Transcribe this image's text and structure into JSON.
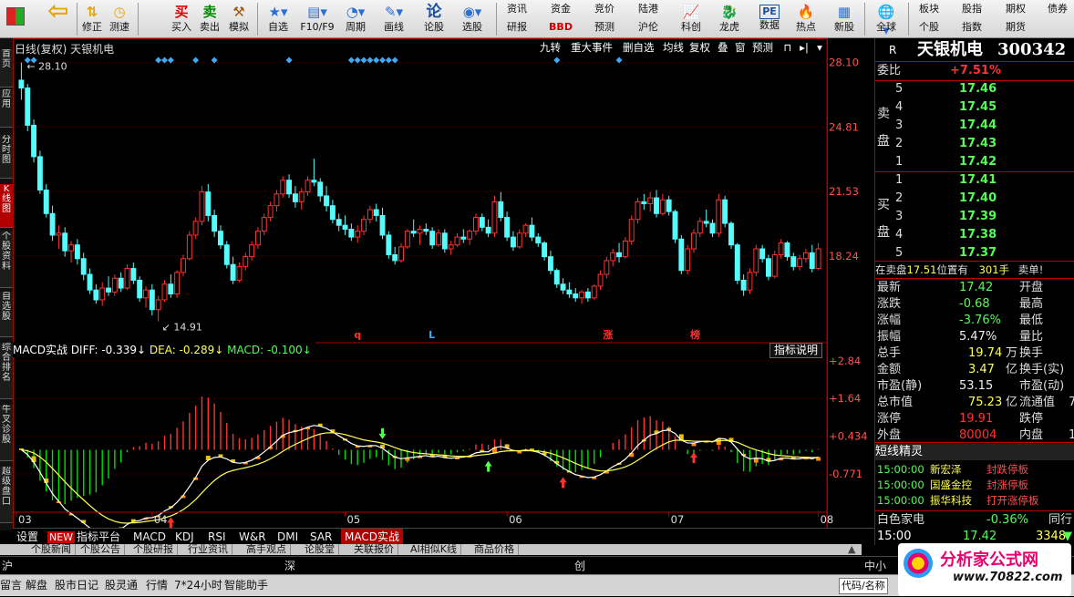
{
  "toolbar": {
    "buttons": [
      {
        "label": "",
        "icon": "grid-icon"
      },
      {
        "label": "",
        "icon": "back-arrow-icon"
      },
      {
        "label": "修正",
        "icon": "up-down-arrows-icon"
      },
      {
        "label": "测速",
        "icon": "clock-icon"
      },
      {
        "label": "买入",
        "icon": "buy-icon",
        "glyph": "买"
      },
      {
        "label": "卖出",
        "icon": "sell-icon",
        "glyph": "卖"
      },
      {
        "label": "模拟",
        "icon": "hammer-icon"
      },
      {
        "label": "自选",
        "icon": "star-icon"
      },
      {
        "label": "F10/F9",
        "icon": "document-icon"
      },
      {
        "label": "周期",
        "icon": "cycle-icon"
      },
      {
        "label": "画线",
        "icon": "pencil-icon"
      },
      {
        "label": "论股",
        "icon": "talk-icon",
        "glyph": "论"
      },
      {
        "label": "选股",
        "icon": "select-icon"
      },
      {
        "label": "科创",
        "icon": "chart-icon"
      },
      {
        "label": "龙虎",
        "icon": "dragon-icon"
      },
      {
        "label": "数据",
        "icon": "pe-icon",
        "glyph": "PE"
      },
      {
        "label": "热点",
        "icon": "hot-icon"
      },
      {
        "label": "新股",
        "icon": "new-stock-icon"
      },
      {
        "label": "全球",
        "icon": "globe-icon"
      }
    ],
    "grid_top": [
      "资讯",
      "资金",
      "竞价",
      "陆港",
      "板块",
      "股指",
      "期权",
      "债券"
    ],
    "grid_bottom": [
      "研报",
      "BBD",
      "预测",
      "沪伦",
      "个股",
      "指数",
      "期货"
    ]
  },
  "left_tabs": [
    "首页",
    "应用",
    "分时图",
    "K线图",
    "个股资料",
    "自选股",
    "综合排名",
    "牛叉诊股",
    "超级盘口"
  ],
  "chart": {
    "title": "日线(复权)  天银机电",
    "menu": [
      "九转",
      "重大事件",
      "删自选",
      "均线",
      "复权",
      "叠",
      "窗",
      "预测"
    ],
    "high_label": "28.10",
    "low_label": "14.91",
    "price_ticks": [
      "28.10",
      "24.81",
      "21.53",
      "18.24"
    ],
    "macd_ticks": [
      "+2.84",
      "+1.64",
      "+0.434",
      "-0.771"
    ],
    "date_labels": [
      "03",
      "04",
      "05",
      "06",
      "07",
      "08"
    ],
    "markers": [
      "q",
      "L",
      "涨",
      "榜"
    ],
    "macd_header": {
      "name": "MACD实战",
      "diff": "DIFF: -0.339↓",
      "dea": "DEA: -0.289↓",
      "macd": "MACD: -0.100↓"
    },
    "indicator_button": "指标说明",
    "colors": {
      "up": "#ff3232",
      "down": "#54fcfc",
      "diff": "#ffffff",
      "dea": "#ffff54",
      "macd": "#00e000",
      "signal": "#3fa9f5"
    }
  },
  "chart_data": {
    "type": "candlestick",
    "ylim": [
      14.0,
      28.5
    ],
    "note": "",
    "ohlc": [
      [
        27.2,
        28.1,
        26.2,
        26.8
      ],
      [
        26.8,
        27.0,
        24.6,
        24.9
      ],
      [
        24.9,
        25.2,
        23.0,
        23.3
      ],
      [
        23.3,
        23.6,
        21.4,
        21.6
      ],
      [
        21.6,
        21.9,
        20.2,
        20.4
      ],
      [
        20.4,
        20.8,
        19.0,
        19.3
      ],
      [
        19.3,
        19.8,
        18.6,
        19.4
      ],
      [
        19.4,
        19.7,
        18.2,
        18.5
      ],
      [
        18.5,
        19.0,
        17.9,
        18.8
      ],
      [
        18.8,
        19.1,
        17.8,
        18.1
      ],
      [
        18.1,
        18.4,
        17.0,
        17.3
      ],
      [
        17.3,
        17.6,
        16.3,
        16.5
      ],
      [
        16.5,
        16.8,
        15.8,
        16.0
      ],
      [
        16.0,
        16.9,
        15.7,
        16.6
      ],
      [
        16.6,
        17.2,
        16.2,
        16.4
      ],
      [
        16.4,
        17.3,
        16.2,
        17.1
      ],
      [
        17.1,
        17.4,
        16.4,
        16.6
      ],
      [
        16.6,
        17.8,
        16.5,
        17.6
      ],
      [
        17.6,
        17.9,
        16.8,
        17.0
      ],
      [
        17.0,
        17.2,
        15.9,
        16.1
      ],
      [
        16.1,
        16.7,
        15.6,
        16.5
      ],
      [
        16.5,
        16.8,
        15.2,
        15.5
      ],
      [
        15.5,
        16.2,
        14.9,
        16.0
      ],
      [
        16.0,
        17.0,
        15.9,
        16.8
      ],
      [
        16.8,
        17.3,
        16.1,
        16.3
      ],
      [
        16.3,
        17.5,
        16.1,
        17.4
      ],
      [
        17.4,
        18.3,
        17.2,
        18.1
      ],
      [
        18.1,
        19.5,
        18.0,
        19.3
      ],
      [
        19.3,
        20.2,
        19.1,
        20.0
      ],
      [
        20.0,
        21.8,
        19.8,
        21.5
      ],
      [
        21.5,
        21.9,
        20.0,
        20.3
      ],
      [
        20.3,
        20.6,
        19.2,
        19.5
      ],
      [
        19.5,
        19.8,
        18.6,
        18.8
      ],
      [
        18.8,
        19.0,
        17.6,
        17.8
      ],
      [
        17.8,
        18.2,
        16.8,
        17.0
      ],
      [
        17.0,
        17.9,
        16.9,
        17.7
      ],
      [
        17.7,
        18.4,
        17.5,
        18.2
      ],
      [
        18.2,
        19.0,
        18.0,
        18.8
      ],
      [
        18.8,
        19.7,
        18.6,
        19.5
      ],
      [
        19.5,
        20.4,
        19.3,
        20.2
      ],
      [
        20.2,
        21.0,
        20.0,
        20.8
      ],
      [
        20.8,
        21.6,
        20.5,
        21.4
      ],
      [
        21.4,
        22.3,
        21.2,
        22.1
      ],
      [
        22.1,
        22.4,
        21.2,
        21.4
      ],
      [
        21.4,
        21.8,
        20.7,
        21.0
      ],
      [
        21.0,
        21.7,
        20.6,
        21.5
      ],
      [
        21.5,
        22.3,
        21.3,
        22.1
      ],
      [
        22.1,
        23.2,
        21.8,
        22.0
      ],
      [
        22.0,
        22.2,
        21.0,
        21.3
      ],
      [
        21.3,
        21.8,
        20.5,
        20.8
      ],
      [
        20.8,
        21.1,
        19.9,
        20.1
      ],
      [
        20.1,
        20.4,
        19.5,
        19.8
      ],
      [
        19.8,
        20.3,
        19.3,
        19.6
      ],
      [
        19.6,
        19.9,
        19.0,
        19.2
      ],
      [
        19.2,
        19.8,
        18.9,
        19.5
      ],
      [
        19.5,
        20.3,
        19.3,
        20.1
      ],
      [
        20.1,
        20.8,
        19.9,
        20.6
      ],
      [
        20.6,
        20.9,
        20.0,
        20.3
      ],
      [
        20.3,
        20.7,
        19.1,
        19.3
      ],
      [
        19.3,
        19.5,
        18.1,
        18.3
      ],
      [
        18.3,
        18.7,
        17.8,
        18.0
      ],
      [
        18.0,
        18.9,
        17.9,
        18.7
      ],
      [
        18.7,
        19.6,
        18.6,
        19.5
      ],
      [
        19.5,
        20.1,
        19.2,
        19.4
      ],
      [
        19.4,
        19.8,
        18.8,
        19.6
      ],
      [
        19.6,
        19.9,
        19.3,
        19.5
      ],
      [
        19.5,
        19.7,
        18.6,
        18.8
      ],
      [
        18.8,
        19.6,
        18.7,
        19.4
      ],
      [
        19.4,
        19.6,
        18.4,
        18.6
      ],
      [
        18.6,
        19.0,
        18.3,
        18.8
      ],
      [
        18.8,
        19.4,
        18.7,
        19.2
      ],
      [
        19.2,
        19.6,
        18.9,
        19.1
      ],
      [
        19.1,
        19.6,
        18.8,
        19.5
      ],
      [
        19.5,
        20.4,
        19.3,
        20.2
      ],
      [
        20.2,
        20.4,
        19.5,
        19.7
      ],
      [
        19.7,
        20.1,
        19.2,
        19.4
      ],
      [
        19.4,
        21.3,
        19.2,
        21.0
      ],
      [
        21.0,
        21.5,
        20.0,
        20.2
      ],
      [
        20.2,
        20.5,
        19.0,
        19.2
      ],
      [
        19.2,
        19.5,
        18.5,
        18.7
      ],
      [
        18.7,
        19.6,
        18.6,
        19.4
      ],
      [
        19.4,
        19.9,
        19.2,
        19.8
      ],
      [
        19.8,
        20.2,
        19.0,
        19.2
      ],
      [
        19.2,
        19.4,
        18.7,
        18.9
      ],
      [
        18.9,
        19.0,
        18.0,
        18.2
      ],
      [
        18.2,
        18.5,
        17.3,
        17.5
      ],
      [
        17.5,
        17.6,
        16.6,
        16.8
      ],
      [
        16.8,
        17.1,
        16.3,
        16.5
      ],
      [
        16.5,
        16.9,
        16.1,
        16.3
      ],
      [
        16.3,
        16.6,
        15.9,
        16.1
      ],
      [
        16.1,
        16.5,
        15.8,
        16.4
      ],
      [
        16.4,
        16.6,
        15.9,
        16.1
      ],
      [
        16.1,
        16.8,
        16.0,
        16.7
      ],
      [
        16.7,
        17.5,
        16.5,
        17.3
      ],
      [
        17.3,
        18.2,
        17.1,
        18.0
      ],
      [
        18.0,
        18.6,
        17.7,
        18.4
      ],
      [
        18.4,
        18.9,
        17.9,
        18.2
      ],
      [
        18.2,
        19.2,
        18.1,
        19.0
      ],
      [
        19.0,
        20.3,
        18.8,
        20.1
      ],
      [
        20.1,
        21.2,
        19.9,
        21.0
      ],
      [
        21.0,
        21.4,
        20.6,
        20.9
      ],
      [
        20.9,
        21.5,
        20.5,
        21.2
      ],
      [
        21.2,
        21.6,
        20.2,
        20.4
      ],
      [
        20.4,
        21.4,
        20.3,
        21.1
      ],
      [
        21.1,
        21.3,
        20.3,
        20.5
      ],
      [
        20.5,
        20.6,
        18.9,
        19.1
      ],
      [
        19.1,
        19.3,
        17.3,
        17.5
      ],
      [
        17.5,
        18.8,
        17.3,
        18.6
      ],
      [
        18.6,
        19.6,
        18.4,
        19.4
      ],
      [
        19.4,
        20.2,
        19.2,
        20.0
      ],
      [
        20.0,
        20.6,
        19.7,
        19.9
      ],
      [
        19.9,
        20.1,
        19.2,
        19.4
      ],
      [
        19.4,
        21.4,
        19.2,
        21.1
      ],
      [
        21.1,
        21.3,
        19.7,
        19.9
      ],
      [
        19.9,
        20.0,
        18.6,
        18.8
      ],
      [
        18.8,
        18.9,
        16.8,
        17.0
      ],
      [
        17.0,
        17.3,
        16.2,
        16.5
      ],
      [
        16.5,
        17.6,
        16.3,
        17.4
      ],
      [
        17.4,
        18.8,
        17.2,
        18.6
      ],
      [
        18.6,
        18.8,
        17.9,
        18.1
      ],
      [
        18.1,
        18.3,
        17.0,
        17.2
      ],
      [
        17.2,
        18.5,
        17.1,
        18.3
      ],
      [
        18.3,
        19.1,
        18.1,
        18.9
      ],
      [
        18.9,
        19.0,
        18.0,
        18.2
      ],
      [
        18.2,
        18.4,
        17.5,
        17.7
      ],
      [
        17.7,
        18.3,
        17.5,
        18.1
      ],
      [
        18.1,
        18.6,
        17.9,
        18.4
      ],
      [
        18.4,
        18.8,
        17.4,
        17.6
      ],
      [
        17.6,
        18.9,
        17.5,
        18.6
      ]
    ]
  },
  "sidebar": {
    "code_prefix": "R",
    "name": "天银机电",
    "code": "300342",
    "weibi_label": "委比",
    "weibi_value": "+7.51%",
    "sell_label": "卖盘",
    "buy_label": "买盘",
    "sell": [
      {
        "n": "5",
        "p": "17.46"
      },
      {
        "n": "4",
        "p": "17.45"
      },
      {
        "n": "3",
        "p": "17.44"
      },
      {
        "n": "2",
        "p": "17.43"
      },
      {
        "n": "1",
        "p": "17.42"
      }
    ],
    "buy": [
      {
        "n": "1",
        "p": "17.41"
      },
      {
        "n": "2",
        "p": "17.40"
      },
      {
        "n": "3",
        "p": "17.39"
      },
      {
        "n": "4",
        "p": "17.38"
      },
      {
        "n": "5",
        "p": "17.37"
      }
    ],
    "notice": {
      "a": "在卖盘",
      "b": "17.51",
      "c": "位置有",
      "d": "301手",
      "e": "卖单!"
    },
    "stats": [
      {
        "l": "最新",
        "v": "17.42",
        "c": "#54fc54",
        "r": "开盘",
        "rv": ""
      },
      {
        "l": "涨跌",
        "v": "-0.68",
        "c": "#54fc54",
        "r": "最高",
        "rv": ""
      },
      {
        "l": "涨幅",
        "v": "-3.76%",
        "c": "#54fc54",
        "r": "最低",
        "rv": ""
      },
      {
        "l": "振幅",
        "v": "5.47%",
        "c": "#eeeeee",
        "r": "量比",
        "rv": ""
      },
      {
        "l": "总手",
        "v": "19.74",
        "u": "万",
        "c": "#ffff54",
        "r": "换手",
        "rv": ""
      },
      {
        "l": "金额",
        "v": "3.47",
        "u": "亿",
        "c": "#ffff54",
        "r": "换手(实)",
        "rv": ""
      },
      {
        "l": "市盈(静)",
        "v": "53.15",
        "c": "#eeeeee",
        "r": "市盈(动)",
        "rv": ""
      },
      {
        "l": "总市值",
        "v": "75.23",
        "u": "亿",
        "c": "#ffff54",
        "r": "流通值",
        "rv": "7"
      },
      {
        "l": "涨停",
        "v": "19.91",
        "c": "#ff3232",
        "r": "跌停",
        "rv": ""
      },
      {
        "l": "外盘",
        "v": "80004",
        "c": "#ff3232",
        "r": "内盘",
        "rv": "1"
      }
    ],
    "short_title": "短线精灵",
    "short_items": [
      {
        "t": "15:00:00",
        "s": "新宏泽",
        "e": "封跌停板"
      },
      {
        "t": "15:00:00",
        "s": "国盛金控",
        "e": "封涨停板"
      },
      {
        "t": "15:00:00",
        "s": "振华科技",
        "e": "打开涨停板"
      }
    ],
    "sector": {
      "name": "白色家电",
      "chg": "-0.36%",
      "tail": "同行"
    },
    "tick": {
      "t": "15:00",
      "p": "17.42",
      "v": "3348"
    },
    "footer_tab": "笔"
  },
  "bottom_tabs": [
    "设置",
    "NEW",
    "指标平台",
    "MACD",
    "KDJ",
    "RSI",
    "W&R",
    "DMI",
    "SAR",
    "MACD实战"
  ],
  "news_tabs": [
    "个股新闻",
    "个股公告",
    "个股研报",
    "行业资讯",
    "高手观点",
    "论股堂",
    "关联报价",
    "AI相似K线",
    "商品价格"
  ],
  "index_bar": {
    "sh": "沪",
    "sz": "深",
    "cy": "创",
    "zx": "中小"
  },
  "status_bar": [
    "留言",
    "解盘",
    "股市日记",
    "股灵通",
    "行情",
    "7*24小时",
    "智能助手"
  ],
  "status_right": "代码/名称",
  "watermark": {
    "name": "分析家公式网",
    "url": "www.70822.com"
  }
}
